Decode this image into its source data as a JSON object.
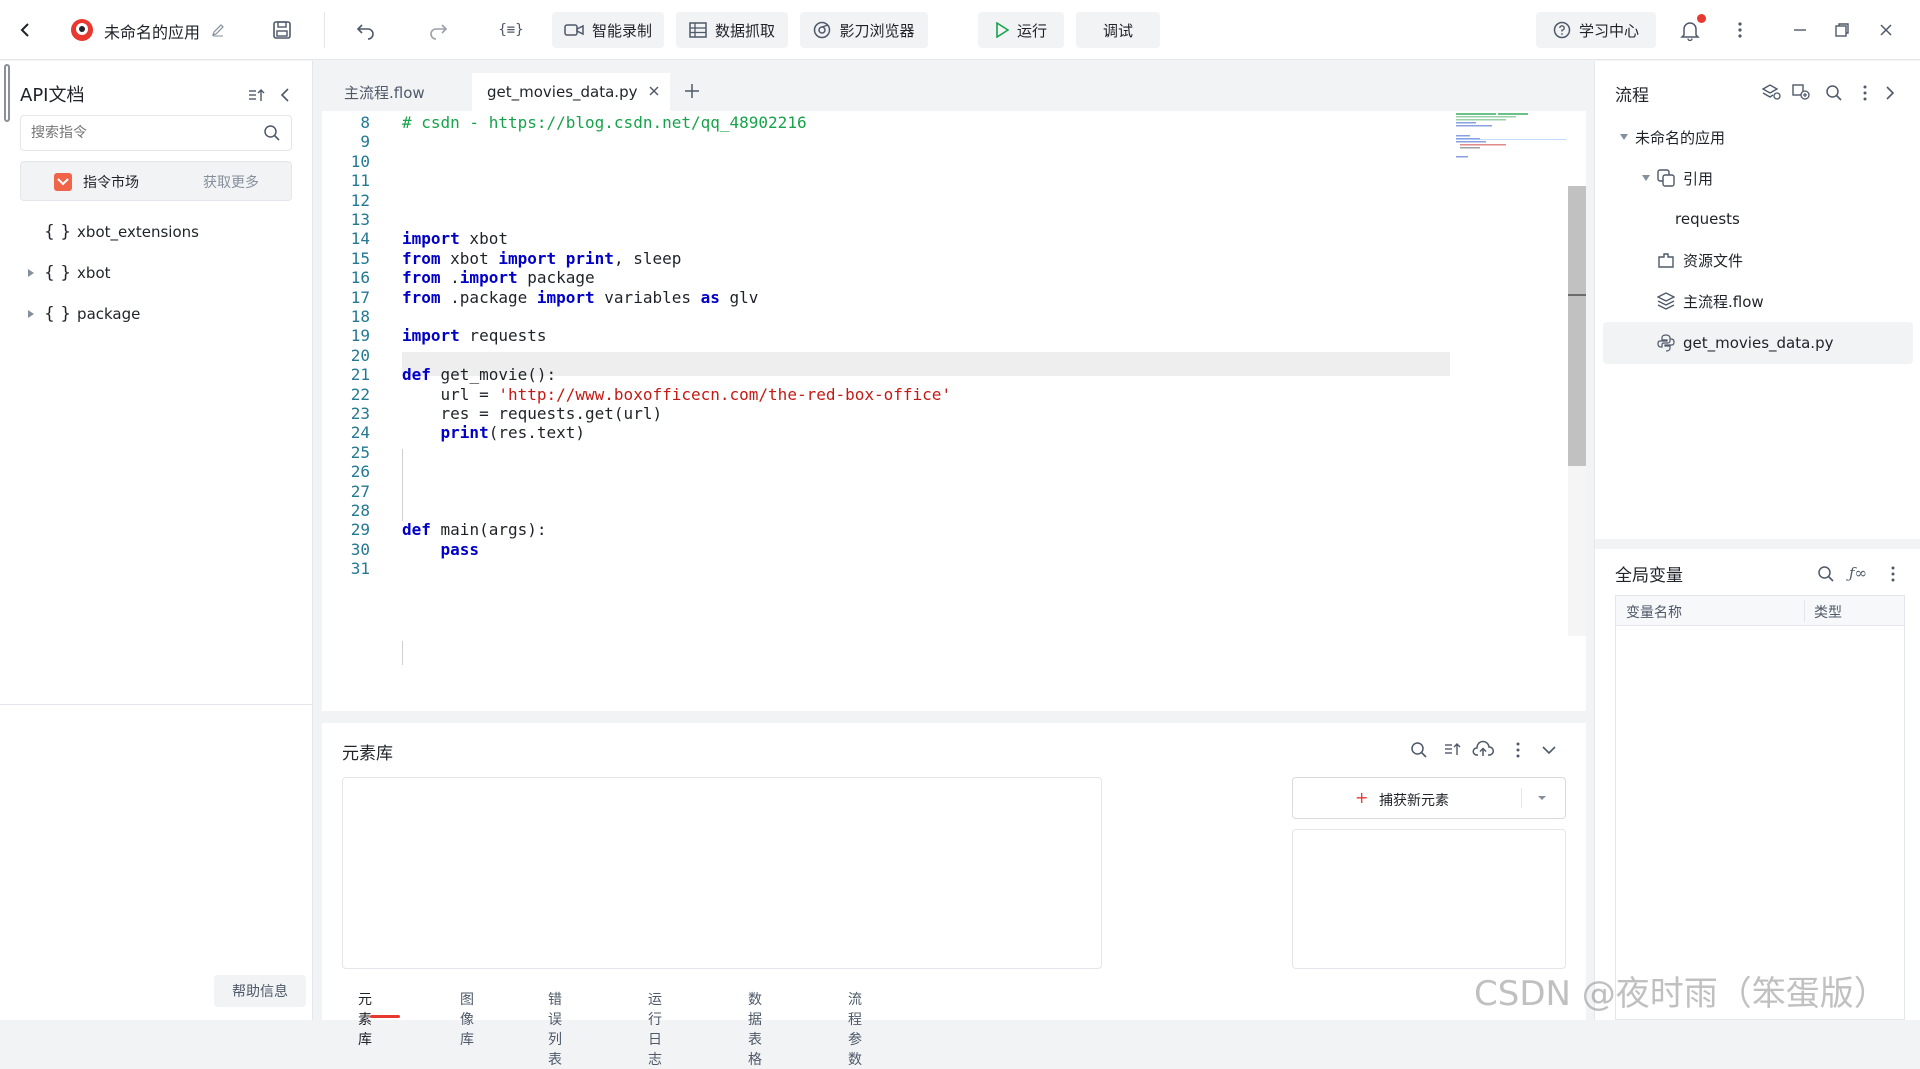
{
  "topbar": {
    "app_name": "未命名的应用",
    "buttons": {
      "smart_record": "智能录制",
      "data_capture": "数据抓取",
      "browser": "影刀浏览器",
      "run": "运行",
      "debug": "调试",
      "learning_center": "学习中心"
    },
    "brace_icon_text": "{≡}"
  },
  "left": {
    "title": "API文档",
    "search_placeholder": "搜索指令",
    "market_label": "指令市场",
    "get_more": "获取更多",
    "items": [
      {
        "brace": "{ }",
        "label": "xbot_extensions"
      },
      {
        "brace": "{ }",
        "label": "xbot"
      },
      {
        "brace": "{ }",
        "label": "package"
      }
    ],
    "help": "帮助信息"
  },
  "editor": {
    "tabs": [
      {
        "label": "主流程.flow"
      },
      {
        "label": "get_movies_data.py"
      }
    ],
    "lines": [
      {
        "n": "8",
        "code": "# csdn - https://blog.csdn.net/qq_48902216"
      },
      {
        "n": "9",
        "code": ""
      },
      {
        "n": "10",
        "code": ""
      },
      {
        "n": "11",
        "code": ""
      },
      {
        "n": "12",
        "code": ""
      },
      {
        "n": "13",
        "code": ""
      },
      {
        "n": "14",
        "code": "import xbot"
      },
      {
        "n": "15",
        "code": "from xbot import print, sleep"
      },
      {
        "n": "16",
        "code": "from .import package"
      },
      {
        "n": "17",
        "code": "from .package import variables as glv"
      },
      {
        "n": "18",
        "code": ""
      },
      {
        "n": "19",
        "code": "import requests"
      },
      {
        "n": "20",
        "code": ""
      },
      {
        "n": "21",
        "code": "def get_movie():"
      },
      {
        "n": "22",
        "code": "    url = 'http://www.boxofficecn.com/the-red-box-office'"
      },
      {
        "n": "23",
        "code": "    res = requests.get(url)"
      },
      {
        "n": "24",
        "code": "    print(res.text)"
      },
      {
        "n": "25",
        "code": ""
      },
      {
        "n": "26",
        "code": ""
      },
      {
        "n": "27",
        "code": ""
      },
      {
        "n": "28",
        "code": ""
      },
      {
        "n": "29",
        "code": "def main(args):"
      },
      {
        "n": "30",
        "code": "    pass"
      },
      {
        "n": "31",
        "code": ""
      }
    ]
  },
  "elements": {
    "title": "元素库",
    "capture_button": "捕获新元素",
    "bottom_tabs": [
      "元素库",
      "图像库",
      "错误列表",
      "运行日志",
      "数据表格",
      "流程参数"
    ]
  },
  "right": {
    "flow_title": "流程",
    "tree": {
      "root": "未命名的应用",
      "ref": "引用",
      "requests": "requests",
      "resources": "资源文件",
      "main_flow": "主流程.flow",
      "py_file": "get_movies_data.py"
    },
    "globals_title": "全局变量",
    "table_headers": [
      "变量名称",
      "类型"
    ]
  },
  "watermark": "CSDN @夜时雨（笨蛋版）",
  "colors": {
    "accent_red": "#e8382f",
    "keyword": "#0000c8",
    "comment": "#16a34a",
    "string": "#c41a16",
    "run_green": "#16a34a"
  }
}
